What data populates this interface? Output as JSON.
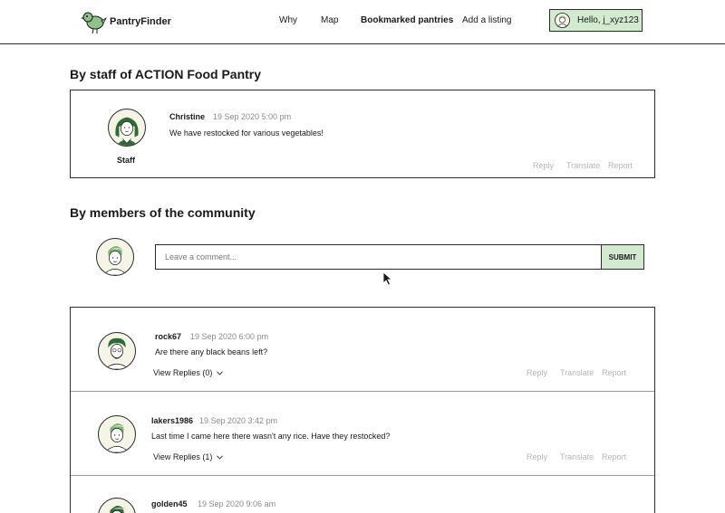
{
  "header": {
    "brand": "PantryFinder",
    "nav": [
      {
        "label": "Why"
      },
      {
        "label": "Map"
      },
      {
        "label": "Bookmarked pantries",
        "active": true
      },
      {
        "label": "Add a listing"
      }
    ],
    "greeting": "Hello, j_xyz123"
  },
  "staff_section": {
    "title": "By staff of ACTION Food Pantry",
    "post": {
      "author": "Christine",
      "time": "19 Sep 2020 5:00 pm",
      "text": "We have restocked for various vegetables!",
      "role_label": "Staff",
      "actions": [
        "Reply",
        "Translate",
        "Report"
      ]
    }
  },
  "community_section": {
    "title": "By members of the community",
    "input_placeholder": "Leave a comment...",
    "submit_label": "SUBMIT",
    "comments": [
      {
        "author": "rock67",
        "time": "19 Sep 2020 6:00 pm",
        "text": "Are there any black beans left?",
        "replies_label": "View Replies (0)",
        "actions": [
          "Reply",
          "Translate",
          "Report"
        ]
      },
      {
        "author": "lakers1986",
        "time": "19 Sep 2020 3:42 pm",
        "text": "Last time I came here there wasn't any rice. Have they restocked?",
        "replies_label": "View Replies (1)",
        "actions": [
          "Reply",
          "Translate",
          "Report"
        ]
      },
      {
        "author": "golden45",
        "time": "19 Sep 2020 9:06 am"
      }
    ]
  },
  "icons": {
    "logo": "bird-logo-icon",
    "user": "user-avatar-icon",
    "chevron": "chevron-down-icon",
    "cursor": "mouse-cursor-icon"
  },
  "colors": {
    "accent_green": "#d3ead0",
    "bird_green": "#8fc28a",
    "avatar_hair": "#7db577",
    "border": "#2a2a2a",
    "muted_text": "#b5b5b5"
  }
}
